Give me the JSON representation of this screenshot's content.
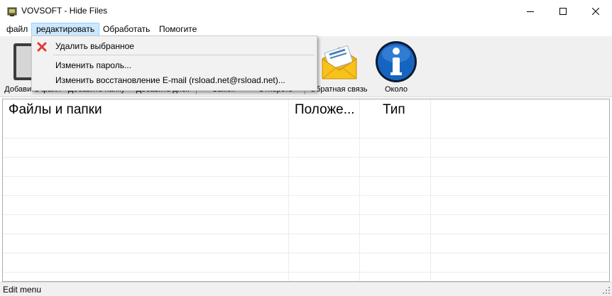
{
  "window": {
    "title": "VOVSOFT - Hide Files",
    "minimize_icon": "minimize-icon",
    "maximize_icon": "maximize-icon",
    "close_icon": "close-icon"
  },
  "menu": {
    "items": [
      {
        "label": "файл"
      },
      {
        "label": "редактировать"
      },
      {
        "label": "Обработать"
      },
      {
        "label": "Помогите"
      }
    ]
  },
  "toolbar": {
    "buttons": [
      {
        "label": "Добавить файл",
        "icon": "add-file-icon"
      },
      {
        "label": "Добавить папку",
        "icon": "add-folder-icon"
      },
      {
        "label": "Добавить диск",
        "icon": "add-drive-icon"
      },
      {
        "label": "Замок",
        "icon": "lock-icon"
      },
      {
        "label": "Отпереть",
        "icon": "unlock-icon"
      },
      {
        "label": "Обратная связь",
        "icon": "feedback-envelope-icon"
      },
      {
        "label": "Около",
        "icon": "info-icon"
      }
    ]
  },
  "table": {
    "columns": [
      {
        "label": "Файлы и папки"
      },
      {
        "label": "Положе..."
      },
      {
        "label": "Тип"
      }
    ],
    "rows": []
  },
  "dropdown": {
    "items": [
      {
        "label": "Удалить выбранное",
        "icon": "delete-x-icon"
      },
      {
        "label": "Изменить пароль..."
      },
      {
        "label": "Изменить восстановление E-mail (rsload.net@rsload.net)..."
      }
    ]
  },
  "status": {
    "text": "Edit menu"
  },
  "colors": {
    "menu_highlight": "#cce8ff",
    "toolbar_bg": "#f0f0f0",
    "info_blue": "#1565c0",
    "envelope_yellow": "#f7c21c",
    "delete_red": "#e53935"
  }
}
